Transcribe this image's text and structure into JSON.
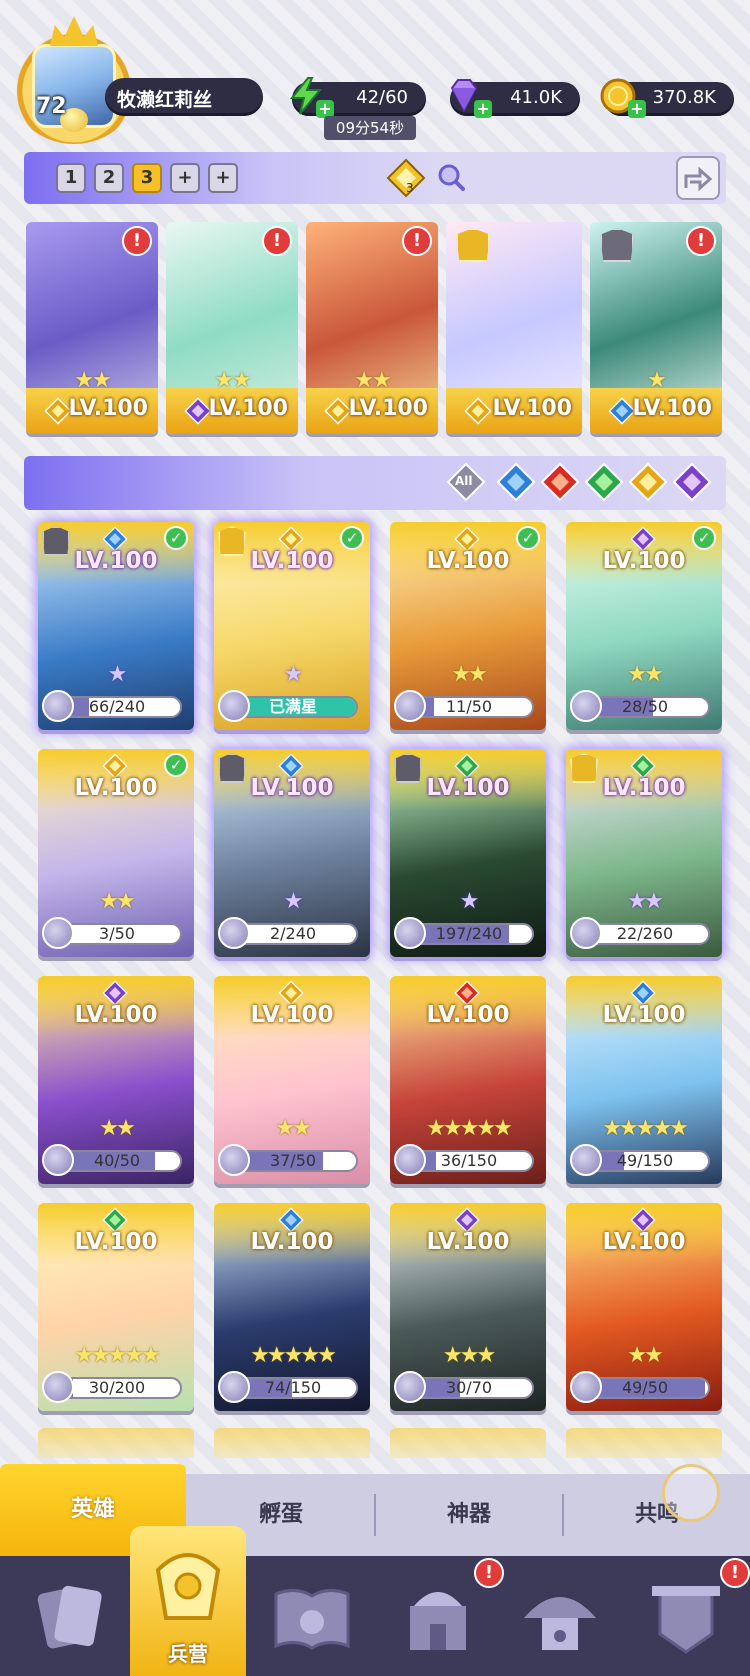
{
  "player": {
    "level": "72",
    "name": "牧濑红莉丝"
  },
  "resources": {
    "energy": {
      "value": "42/60",
      "timer": "09分54秒",
      "icon": "lightning-icon"
    },
    "gems": {
      "value": "41.0K",
      "icon": "diamond-icon"
    },
    "coins": {
      "value": "370.8K",
      "icon": "coin-icon"
    }
  },
  "team_bar": {
    "slots": [
      "1",
      "2",
      "3",
      "+",
      "+"
    ],
    "active_slot": "3",
    "power_count": "3"
  },
  "team_cards": [
    {
      "level": "LV.100",
      "element": "light",
      "stars": "★★",
      "alert": "!"
    },
    {
      "level": "LV.100",
      "element": "dark",
      "stars": "★★",
      "alert": "!"
    },
    {
      "level": "LV.100",
      "element": "light",
      "stars": "★★",
      "alert": "!"
    },
    {
      "level": "LV.100",
      "element": "light",
      "stars": "",
      "alert": ""
    },
    {
      "level": "LV.100",
      "element": "water",
      "stars": "★",
      "alert": "!"
    }
  ],
  "filter": {
    "all_label": "All",
    "elements": [
      "water",
      "fire",
      "wind",
      "light",
      "dark"
    ]
  },
  "heroes": [
    {
      "level": "LV.100",
      "element": "water",
      "progress": "66/240",
      "fill": 0.275,
      "stars": "★",
      "checked": true,
      "rank": "silver",
      "selected": true
    },
    {
      "level": "LV.100",
      "element": "light",
      "progress": "已满星",
      "fill": 1.0,
      "stars": "★",
      "checked": true,
      "rank": "gold",
      "selected": true
    },
    {
      "level": "LV.100",
      "element": "light",
      "progress": "11/50",
      "fill": 0.22,
      "stars": "★★",
      "checked": true,
      "rank": "",
      "selected": false
    },
    {
      "level": "LV.100",
      "element": "dark",
      "progress": "28/50",
      "fill": 0.56,
      "stars": "★★",
      "checked": true,
      "rank": "",
      "selected": false
    },
    {
      "level": "LV.100",
      "element": "light",
      "progress": "3/50",
      "fill": 0.06,
      "stars": "★★",
      "checked": true,
      "rank": "",
      "selected": false
    },
    {
      "level": "LV.100",
      "element": "water",
      "progress": "2/240",
      "fill": 0.01,
      "stars": "★",
      "checked": false,
      "rank": "silver",
      "selected": true
    },
    {
      "level": "LV.100",
      "element": "wind",
      "progress": "197/240",
      "fill": 0.82,
      "stars": "★",
      "checked": false,
      "rank": "silver",
      "selected": true
    },
    {
      "level": "LV.100",
      "element": "wind",
      "progress": "22/260",
      "fill": 0.085,
      "stars": "★★",
      "checked": false,
      "rank": "gold",
      "selected": true
    },
    {
      "level": "LV.100",
      "element": "dark",
      "progress": "40/50",
      "fill": 0.8,
      "stars": "★★",
      "checked": false,
      "rank": "",
      "selected": false
    },
    {
      "level": "LV.100",
      "element": "light",
      "progress": "37/50",
      "fill": 0.74,
      "stars": "★★",
      "checked": false,
      "rank": "",
      "selected": false
    },
    {
      "level": "LV.100",
      "element": "fire",
      "progress": "36/150",
      "fill": 0.24,
      "stars": "★★★★★",
      "checked": false,
      "rank": "",
      "selected": false
    },
    {
      "level": "LV.100",
      "element": "water",
      "progress": "49/150",
      "fill": 0.33,
      "stars": "★★★★★",
      "checked": false,
      "rank": "",
      "selected": false
    },
    {
      "level": "LV.100",
      "element": "wind",
      "progress": "30/200",
      "fill": 0.15,
      "stars": "★★★★★",
      "checked": false,
      "rank": "",
      "selected": false
    },
    {
      "level": "LV.100",
      "element": "water",
      "progress": "74/150",
      "fill": 0.49,
      "stars": "★★★★★",
      "checked": false,
      "rank": "",
      "selected": false
    },
    {
      "level": "LV.100",
      "element": "dark",
      "progress": "30/70",
      "fill": 0.43,
      "stars": "★★★",
      "checked": false,
      "rank": "",
      "selected": false
    },
    {
      "level": "LV.100",
      "element": "dark",
      "progress": "49/50",
      "fill": 0.98,
      "stars": "★★",
      "checked": false,
      "rank": "",
      "selected": false
    }
  ],
  "sub_tabs": [
    "英雄",
    "孵蛋",
    "神器",
    "共鸣"
  ],
  "bottom_nav": [
    {
      "icon": "cards-icon",
      "label": "",
      "alert": false
    },
    {
      "icon": "barracks-icon",
      "label": "兵营",
      "alert": false,
      "active": true
    },
    {
      "icon": "book-icon",
      "label": "",
      "alert": false
    },
    {
      "icon": "castle-icon",
      "label": "",
      "alert": true
    },
    {
      "icon": "mushroom-house-icon",
      "label": "",
      "alert": false
    },
    {
      "icon": "shield-banner-icon",
      "label": "",
      "alert": true
    }
  ],
  "colors": {
    "accent_yellow": "#f5b50c",
    "accent_purple": "#7d6ff0",
    "element_water": "#2d7fd8",
    "element_fire": "#d92b22",
    "element_wind": "#2aa84a",
    "element_light": "#e6a514",
    "element_dark": "#7b3fc9",
    "alert_red": "#e23b3b",
    "check_green": "#3fbf52"
  }
}
